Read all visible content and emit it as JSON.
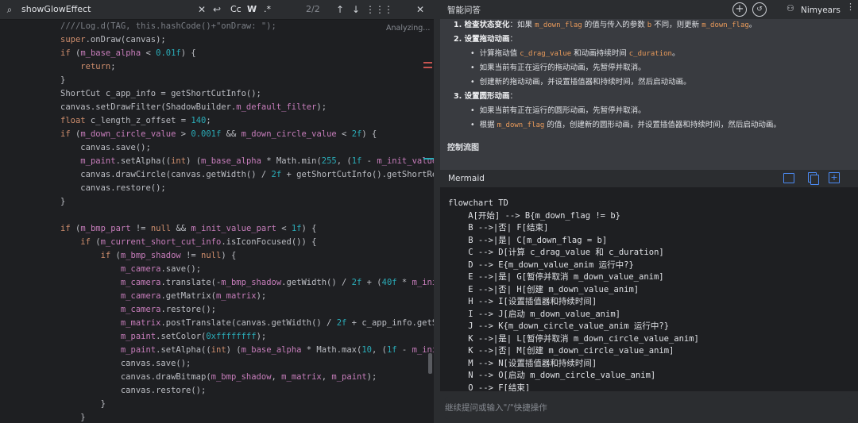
{
  "find_bar": {
    "query": "showGlowEffect",
    "case_label": "Cc",
    "word_label": "W",
    "regex_label": ".*",
    "match_count": "2/2"
  },
  "editor": {
    "status": "Analyzing...",
    "lines": [
      [
        [
          "c",
          "////Log.d(TAG, this.hashCode()+\"onDraw: \");"
        ]
      ],
      [
        [
          "k",
          "super"
        ],
        [
          "t",
          ".onDraw(canvas);"
        ]
      ],
      [
        [
          "k",
          "if"
        ],
        [
          "t",
          " ("
        ],
        [
          "f",
          "m_base_alpha"
        ],
        [
          "t",
          " < "
        ],
        [
          "n",
          "0.01f"
        ],
        [
          "t",
          ") {"
        ]
      ],
      [
        [
          "t",
          "    "
        ],
        [
          "k",
          "return"
        ],
        [
          "t",
          ";"
        ]
      ],
      [
        [
          "t",
          "}"
        ]
      ],
      [
        [
          "t",
          "ShortCut c_app_info = getShortCutInfo();"
        ]
      ],
      [
        [
          "t",
          "canvas.setDrawFilter(ShadowBuilder."
        ],
        [
          "f",
          "m_default_filter"
        ],
        [
          "t",
          ");"
        ]
      ],
      [
        [
          "k",
          "float"
        ],
        [
          "t",
          " c_length_z_offset = "
        ],
        [
          "n",
          "140"
        ],
        [
          "t",
          ";"
        ]
      ],
      [
        [
          "k",
          "if"
        ],
        [
          "t",
          " ("
        ],
        [
          "f",
          "m_down_circle_value"
        ],
        [
          "t",
          " > "
        ],
        [
          "n",
          "0.001f"
        ],
        [
          "t",
          " && "
        ],
        [
          "f",
          "m_down_circle_value"
        ],
        [
          "t",
          " < "
        ],
        [
          "n",
          "2f"
        ],
        [
          "t",
          ") {"
        ]
      ],
      [
        [
          "t",
          "    canvas.save();"
        ]
      ],
      [
        [
          "t",
          "    "
        ],
        [
          "f",
          "m_paint"
        ],
        [
          "t",
          ".setAlpha(("
        ],
        [
          "k",
          "int"
        ],
        [
          "t",
          ") ("
        ],
        [
          "f",
          "m_base_alpha"
        ],
        [
          "t",
          " * Math.min("
        ],
        [
          "n",
          "255"
        ],
        [
          "t",
          ", ("
        ],
        [
          "n",
          "1f"
        ],
        [
          "t",
          " - "
        ],
        [
          "f",
          "m_init_value_"
        ]
      ],
      [
        [
          "t",
          "    canvas.drawCircle(canvas.getWidth() / "
        ],
        [
          "n",
          "2f"
        ],
        [
          "t",
          " + getShortCutInfo().getShortRea"
        ]
      ],
      [
        [
          "t",
          "    canvas.restore();"
        ]
      ],
      [
        [
          "t",
          "}"
        ]
      ],
      [
        [
          "t",
          ""
        ]
      ],
      [
        [
          "k",
          "if"
        ],
        [
          "t",
          " ("
        ],
        [
          "f",
          "m_bmp_part"
        ],
        [
          "t",
          " != "
        ],
        [
          "k",
          "null"
        ],
        [
          "t",
          " && "
        ],
        [
          "f",
          "m_init_value_part"
        ],
        [
          "t",
          " < "
        ],
        [
          "n",
          "1f"
        ],
        [
          "t",
          ")"
        ],
        [
          "t",
          " {"
        ]
      ],
      [
        [
          "t",
          "    "
        ],
        [
          "k",
          "if"
        ],
        [
          "t",
          " ("
        ],
        [
          "f",
          "m_current_short_cut_info"
        ],
        [
          "t",
          ".isIconFocused()) {"
        ]
      ],
      [
        [
          "t",
          "        "
        ],
        [
          "k",
          "if"
        ],
        [
          "t",
          " ("
        ],
        [
          "f",
          "m_bmp_shadow"
        ],
        [
          "t",
          " != "
        ],
        [
          "k",
          "null"
        ],
        [
          "t",
          ") {"
        ]
      ],
      [
        [
          "t",
          "            "
        ],
        [
          "f",
          "m_camera"
        ],
        [
          "t",
          ".save();"
        ]
      ],
      [
        [
          "t",
          "            "
        ],
        [
          "f",
          "m_camera"
        ],
        [
          "t",
          ".translate(-"
        ],
        [
          "f",
          "m_bmp_shadow"
        ],
        [
          "t",
          ".getWidth() / "
        ],
        [
          "n",
          "2f"
        ],
        [
          "t",
          " + ("
        ],
        [
          "n",
          "40f"
        ],
        [
          "t",
          " * "
        ],
        [
          "f",
          "m_init"
        ]
      ],
      [
        [
          "t",
          "            "
        ],
        [
          "f",
          "m_camera"
        ],
        [
          "t",
          ".getMatrix("
        ],
        [
          "f",
          "m_matrix"
        ],
        [
          "t",
          ");"
        ]
      ],
      [
        [
          "t",
          "            "
        ],
        [
          "f",
          "m_camera"
        ],
        [
          "t",
          ".restore();"
        ]
      ],
      [
        [
          "t",
          "            "
        ],
        [
          "f",
          "m_matrix"
        ],
        [
          "t",
          ".postTranslate(canvas.getWidth() / "
        ],
        [
          "n",
          "2f"
        ],
        [
          "t",
          " + c_app_info.getSh"
        ]
      ],
      [
        [
          "t",
          "            "
        ],
        [
          "f",
          "m_paint"
        ],
        [
          "t",
          ".setColor("
        ],
        [
          "n",
          "0xffffffff"
        ],
        [
          "t",
          ");"
        ]
      ],
      [
        [
          "t",
          "            "
        ],
        [
          "f",
          "m_paint"
        ],
        [
          "t",
          ".setAlpha(("
        ],
        [
          "k",
          "int"
        ],
        [
          "t",
          ") ("
        ],
        [
          "f",
          "m_base_alpha"
        ],
        [
          "t",
          " * Math.max("
        ],
        [
          "n",
          "10"
        ],
        [
          "t",
          ", ("
        ],
        [
          "n",
          "1f"
        ],
        [
          "t",
          " - "
        ],
        [
          "f",
          "m_init"
        ]
      ],
      [
        [
          "t",
          "            canvas.save();"
        ]
      ],
      [
        [
          "t",
          "            canvas.drawBitmap("
        ],
        [
          "f",
          "m_bmp_shadow"
        ],
        [
          "t",
          ", "
        ],
        [
          "f",
          "m_matrix"
        ],
        [
          "t",
          ", "
        ],
        [
          "f",
          "m_paint"
        ],
        [
          "t",
          ");"
        ]
      ],
      [
        [
          "t",
          "            canvas.restore();"
        ]
      ],
      [
        [
          "t",
          "        }"
        ]
      ],
      [
        [
          "t",
          "    }"
        ]
      ]
    ]
  },
  "panel": {
    "title": "智能问答",
    "user": "Nimyears"
  },
  "doc": {
    "l1_bold": "1. 检查状态变化",
    "l1_a": "：如果 ",
    "l1_code1": "m_down_flag",
    "l1_b": " 的值与传入的参数 ",
    "l1_code2": "b",
    "l1_c": " 不同，则更新 ",
    "l1_code3": "m_down_flag",
    "l1_d": "。",
    "h2": "2. 设置拖动动画",
    "h2_colon": "：",
    "b1_a": "计算拖动值 ",
    "b1_code1": "c_drag_value",
    "b1_b": " 和动画持续时间 ",
    "b1_code2": "c_duration",
    "b1_c": "。",
    "b2": "如果当前有正在运行的拖动动画，先暂停并取消。",
    "b3": "创建新的拖动动画，并设置插值器和持续时间，然后启动动画。",
    "h3": "3. 设置圆形动画",
    "h3_colon": "：",
    "b4": "如果当前有正在运行的圆形动画，先暂停并取消。",
    "b5_a": "根据 ",
    "b5_code": "m_down_flag",
    "b5_b": " 的值，创建新的圆形动画，并设置插值器和持续时间，然后启动动画。",
    "section": "控制流图"
  },
  "mermaid": {
    "label": "Mermaid",
    "lines": [
      "flowchart TD",
      "    A[开始] --> B{m_down_flag != b}",
      "    B -->|否| F[结束]",
      "    B -->|是| C[m_down_flag = b]",
      "    C --> D[计算 c_drag_value 和 c_duration]",
      "    D --> E{m_down_value_anim 运行中?}",
      "    E -->|是| G[暂停并取消 m_down_value_anim]",
      "    E -->|否| H[创建 m_down_value_anim]",
      "    H --> I[设置插值器和持续时间]",
      "    I --> J[启动 m_down_value_anim]",
      "    J --> K{m_down_circle_value_anim 运行中?}",
      "    K -->|是| L[暂停并取消 m_down_circle_value_anim]",
      "    K -->|否| M[创建 m_down_circle_value_anim]",
      "    M --> N[设置插值器和持续时间]",
      "    N --> O[启动 m_down_circle_value_anim]",
      "    O --> F[结束]"
    ]
  },
  "input": {
    "placeholder": "继续提问或输入\"/\"快捷操作"
  }
}
